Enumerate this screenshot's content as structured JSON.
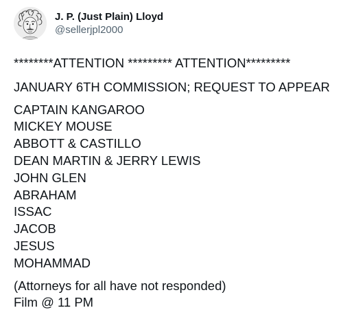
{
  "author": {
    "display_name": "J. P. (Just Plain) Lloyd",
    "handle": "@sellerjpl2000",
    "avatar_icon": "einstein-sketch-avatar"
  },
  "tweet": {
    "headline": "********ATTENTION ********* ATTENTION*********",
    "subject": "JANUARY 6TH COMMISSION; REQUEST TO APPEAR",
    "names": [
      "CAPTAIN KANGAROO",
      "MICKEY MOUSE",
      "ABBOTT & CASTILLO",
      "DEAN MARTIN & JERRY LEWIS",
      "JOHN GLEN",
      "ABRAHAM",
      "ISSAC",
      "JACOB",
      "JESUS",
      "MOHAMMAD"
    ],
    "note": "(Attorneys for all have not responded)",
    "film_time": "Film @ 11 PM"
  },
  "colors": {
    "text_primary": "#0f1419",
    "text_secondary": "#536471",
    "background": "#ffffff"
  }
}
